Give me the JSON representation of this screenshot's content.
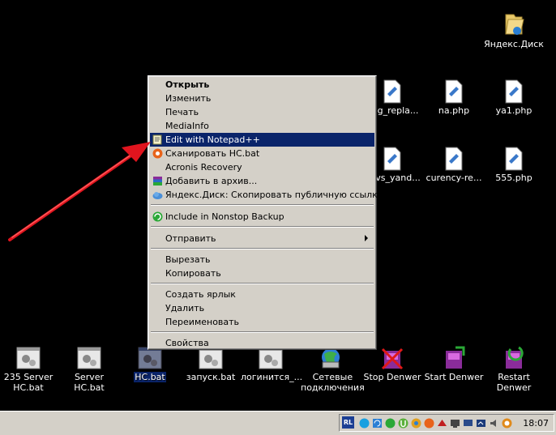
{
  "desktop_icons": {
    "yandex_disk": "Яндекс.Диск",
    "g_repla": "g_repla...",
    "na_php": "na.php",
    "ya1_php": "ya1.php",
    "vs_yand": "vs_yand...",
    "curency_re": "curency-re...",
    "php555": "555.php",
    "server235": "235 Server\nHC.bat",
    "server_hc": "Server HC.bat",
    "hc_bat": "HC.bat",
    "zapusk": "запуск.bat",
    "loginitsya": "логинится_...",
    "network": "Сетевые\nподключения",
    "stop_denwer": "Stop Denwer",
    "start_denwer": "Start Denwer",
    "restart_denwer": "Restart\nDenwer"
  },
  "context_menu": {
    "open": "Открыть",
    "edit": "Изменить",
    "print": "Печать",
    "mediainfo": "MediaInfo",
    "notepadpp": "Edit with Notepad++",
    "scan": "Сканировать HC.bat",
    "acronis": "Acronis Recovery",
    "archive": "Добавить в архив...",
    "yandex_link": "Яндекс.Диск: Скопировать публичную ссылку",
    "nonstop": "Include in Nonstop Backup",
    "send_to": "Отправить",
    "cut": "Вырезать",
    "copy": "Копировать",
    "shortcut": "Создать ярлык",
    "delete": "Удалить",
    "rename": "Переименовать",
    "properties": "Свойства"
  },
  "taskbar": {
    "lang": "RL",
    "clock": "18:07"
  },
  "colors": {
    "highlight": "#0a246a",
    "menu_bg": "#d4d0c8",
    "arrow": "#e0141e"
  }
}
